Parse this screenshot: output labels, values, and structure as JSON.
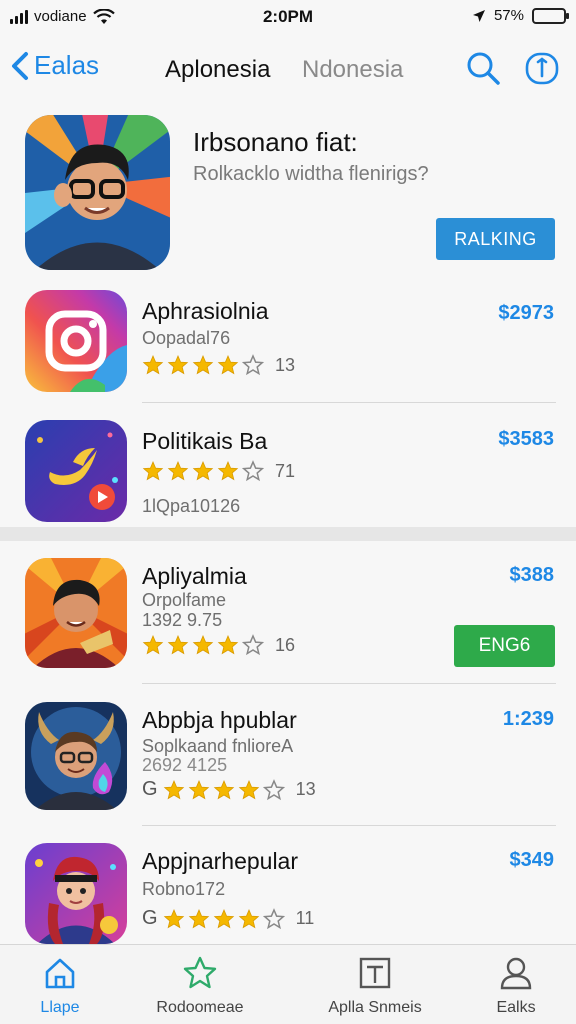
{
  "status_bar": {
    "carrier": "vodiane",
    "time": "2:0PM",
    "battery": "57%",
    "battery_level": 0.57
  },
  "nav": {
    "back_label": "Ealas",
    "title": "Aplonesia",
    "subtitle": "Ndonesia"
  },
  "featured": {
    "title": "Irbsonano fiat:",
    "subtitle": "Rolkacklo widtha flenirigs?",
    "button_label": "RALKING"
  },
  "apps": [
    {
      "name": "Aphrasiolnia",
      "line1": "Oopadal76",
      "price": "$2973",
      "rating": 4.0,
      "rating_count": "13",
      "prefix": ""
    },
    {
      "name": "Politikais Ba",
      "line2": "1lQpa10126",
      "price": "$3583",
      "rating": 4.0,
      "rating_count": "71",
      "prefix": ""
    },
    {
      "name": "Apliyalmia",
      "line1": "Orpolfame",
      "line2": "1392 9.75",
      "price": "$388",
      "rating": 4.0,
      "rating_count": "16",
      "prefix": "",
      "button_label": "ENG6"
    },
    {
      "name": "Abpbja hpublar",
      "line1": "Soplkaand fnlioreA",
      "line2": "2692 4125",
      "price": "1:239",
      "rating": 4.0,
      "rating_count": "13",
      "prefix": "G"
    },
    {
      "name": "Appjnarhepular",
      "line1": "Robno172",
      "price": "$349",
      "rating": 4.0,
      "rating_count": "11",
      "prefix": "G"
    }
  ],
  "tabs": [
    {
      "label": "Llape",
      "icon": "home-icon",
      "active": true
    },
    {
      "label": "Rodoomeae",
      "icon": "star-icon",
      "active": false
    },
    {
      "label": "Aplla Snmeis",
      "icon": "apps-icon",
      "active": false
    },
    {
      "label": "Ealks",
      "icon": "person-icon",
      "active": false
    }
  ],
  "colors": {
    "accent": "#1e88e5",
    "ranking_button": "#2b8fd6",
    "get_button": "#2eaa4a",
    "star": "#f5b800"
  }
}
